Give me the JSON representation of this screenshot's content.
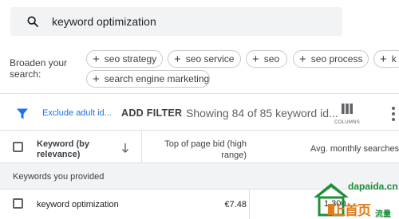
{
  "search": {
    "query": "keyword optimization"
  },
  "broaden": {
    "label": "Broaden your search:",
    "chips": [
      "seo strategy",
      "seo service",
      "seo",
      "seo process",
      "k",
      "search engine marketing"
    ]
  },
  "toolbar": {
    "exclude_label": "Exclude adult id...",
    "add_filter": "ADD FILTER",
    "showing": "Showing 84 of 85 keyword id...",
    "columns_label": "COLUMNS"
  },
  "table": {
    "headers": {
      "keyword": "Keyword (by relevance)",
      "bid": "Top of page bid (high range)",
      "avg": "Avg. monthly searches"
    },
    "section_title": "Keywords you provided",
    "rows": [
      {
        "keyword": "keyword optimization",
        "bid": "€7.48",
        "avg": "1,300"
      }
    ]
  },
  "watermark": {
    "url": "dapaida.cn",
    "cn_main": "上首页",
    "cn_sub": "流量"
  },
  "colors": {
    "accent": "#1a73e8",
    "watermark_green": "#1e8f3a",
    "watermark_orange": "#e07b1a"
  }
}
